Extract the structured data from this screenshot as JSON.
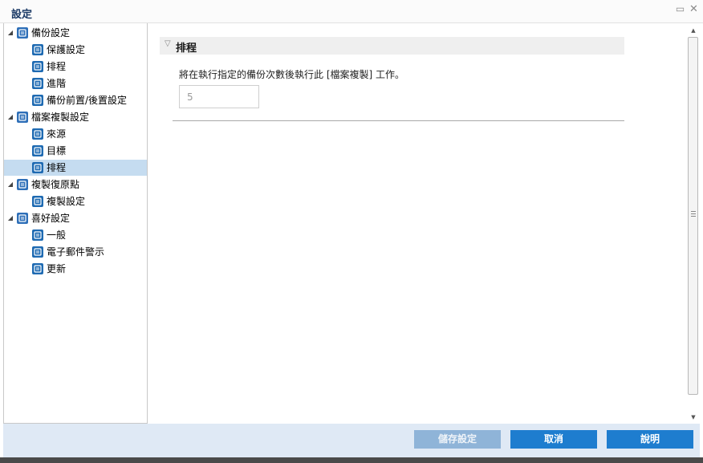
{
  "window": {
    "title": "設定",
    "restore_icon": "restore-icon",
    "close_icon": "close-icon"
  },
  "tree": [
    {
      "label": "備份設定",
      "level": 1,
      "icon": "backup-settings-icon",
      "color": "#2e6fb8"
    },
    {
      "label": "保護設定",
      "level": 2,
      "icon": "protection-icon",
      "color": "#1e6ab2"
    },
    {
      "label": "排程",
      "level": 2,
      "icon": "schedule-icon",
      "color": "#1e6ab2"
    },
    {
      "label": "進階",
      "level": 2,
      "icon": "advanced-icon",
      "color": "#1e6ab2"
    },
    {
      "label": "備份前置/後置設定",
      "level": 2,
      "icon": "wrench-icon",
      "color": "#1e6ab2"
    },
    {
      "label": "檔案複製設定",
      "level": 1,
      "icon": "file-copy-settings-icon",
      "color": "#2e6fb8"
    },
    {
      "label": "來源",
      "level": 2,
      "icon": "source-icon",
      "color": "#1e6ab2"
    },
    {
      "label": "目標",
      "level": 2,
      "icon": "destination-icon",
      "color": "#1e6ab2"
    },
    {
      "label": "排程",
      "level": 2,
      "icon": "schedule-icon",
      "color": "#1e6ab2",
      "selected": true
    },
    {
      "label": "複製復原點",
      "level": 1,
      "icon": "copy-recovery-point-icon",
      "color": "#2e6fb8"
    },
    {
      "label": "複製設定",
      "level": 2,
      "icon": "copy-settings-icon",
      "color": "#1e6ab2"
    },
    {
      "label": "喜好設定",
      "level": 1,
      "icon": "preferences-icon",
      "color": "#2e6fb8"
    },
    {
      "label": "一般",
      "level": 2,
      "icon": "general-icon",
      "color": "#1e6ab2"
    },
    {
      "label": "電子郵件警示",
      "level": 2,
      "icon": "email-alert-icon",
      "color": "#1e6ab2"
    },
    {
      "label": "更新",
      "level": 2,
      "icon": "update-icon",
      "color": "#1e6ab2"
    }
  ],
  "main": {
    "section_title": "排程",
    "description": "將在執行指定的備份次數後執行此 [檔案複製] 工作。",
    "backup_count_value": "5"
  },
  "footer": {
    "save_label": "儲存設定",
    "cancel_label": "取消",
    "help_label": "說明"
  },
  "colors": {
    "accent": "#1e7dcf",
    "selection": "#c5dcf0",
    "footer_bg": "#dfe9f5"
  }
}
